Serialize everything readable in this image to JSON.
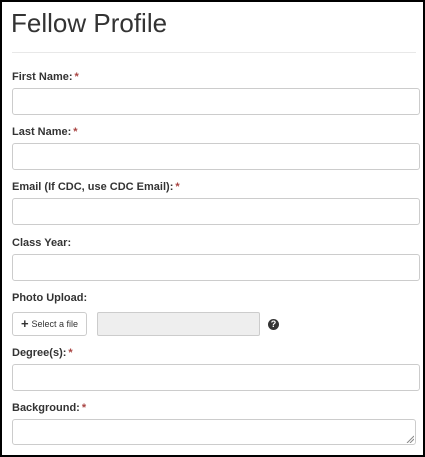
{
  "form": {
    "title": "Fellow Profile",
    "required_marker": "*",
    "fields": {
      "first_name": {
        "label": "First Name:",
        "value": ""
      },
      "last_name": {
        "label": "Last Name:",
        "value": ""
      },
      "email": {
        "label": "Email (If CDC, use CDC Email):",
        "value": ""
      },
      "class_year": {
        "label": "Class Year:",
        "value": ""
      },
      "photo_upload": {
        "label": "Photo Upload:",
        "button_label": "Select a file",
        "file_name": "",
        "help_icon": "question-circle-icon"
      },
      "degrees": {
        "label": "Degree(s):",
        "value": ""
      },
      "background": {
        "label": "Background:",
        "value": ""
      }
    }
  },
  "colors": {
    "required": "#a94442",
    "border": "#cccccc",
    "disabled_field": "#eeeeee",
    "text": "#333333"
  }
}
